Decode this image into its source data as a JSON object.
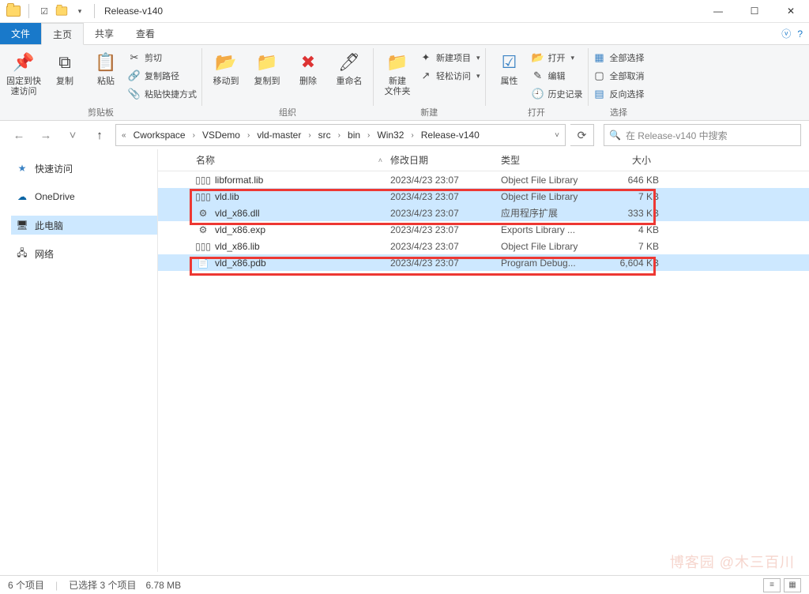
{
  "window": {
    "title": "Release-v140"
  },
  "tabs": {
    "file": "文件",
    "home": "主页",
    "share": "共享",
    "view": "查看"
  },
  "ribbon": {
    "pin": "固定到快\n速访问",
    "copy": "复制",
    "paste": "粘贴",
    "cut": "剪切",
    "copy_path": "复制路径",
    "paste_shortcut": "粘贴快捷方式",
    "clipboard_group": "剪贴板",
    "move_to": "移动到",
    "copy_to": "复制到",
    "delete": "删除",
    "rename": "重命名",
    "organize_group": "组织",
    "new_folder": "新建\n文件夹",
    "new_item": "新建项目",
    "easy_access": "轻松访问",
    "new_group": "新建",
    "properties": "属性",
    "open": "打开",
    "edit": "编辑",
    "history": "历史记录",
    "open_group": "打开",
    "select_all": "全部选择",
    "select_none": "全部取消",
    "invert_selection": "反向选择",
    "select_group": "选择"
  },
  "breadcrumb": {
    "items": [
      "Cworkspace",
      "VSDemo",
      "vld-master",
      "src",
      "bin",
      "Win32",
      "Release-v140"
    ]
  },
  "search": {
    "placeholder": "在 Release-v140 中搜索"
  },
  "sidebar": {
    "quick_access": "快速访问",
    "onedrive": "OneDrive",
    "this_pc": "此电脑",
    "network": "网络"
  },
  "columns": {
    "name": "名称",
    "date": "修改日期",
    "type": "类型",
    "size": "大小"
  },
  "files": [
    {
      "icon": "lib",
      "name": "libformat.lib",
      "date": "2023/4/23 23:07",
      "type": "Object File Library",
      "size": "646 KB",
      "selected": false
    },
    {
      "icon": "lib",
      "name": "vld.lib",
      "date": "2023/4/23 23:07",
      "type": "Object File Library",
      "size": "7 KB",
      "selected": true
    },
    {
      "icon": "dll",
      "name": "vld_x86.dll",
      "date": "2023/4/23 23:07",
      "type": "应用程序扩展",
      "size": "333 KB",
      "selected": true
    },
    {
      "icon": "exp",
      "name": "vld_x86.exp",
      "date": "2023/4/23 23:07",
      "type": "Exports Library ...",
      "size": "4 KB",
      "selected": false
    },
    {
      "icon": "lib",
      "name": "vld_x86.lib",
      "date": "2023/4/23 23:07",
      "type": "Object File Library",
      "size": "7 KB",
      "selected": false
    },
    {
      "icon": "pdb",
      "name": "vld_x86.pdb",
      "date": "2023/4/23 23:07",
      "type": "Program Debug...",
      "size": "6,604 KB",
      "selected": true
    }
  ],
  "status": {
    "count": "6 个项目",
    "selection": "已选择 3 个项目　6.78 MB"
  },
  "watermark": "博客园 @木三百川"
}
